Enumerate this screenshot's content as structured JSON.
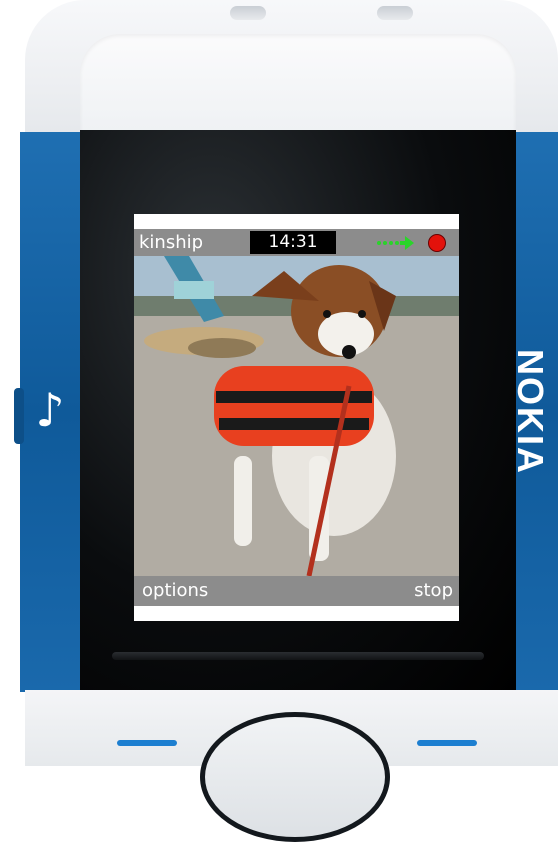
{
  "device": {
    "brand": "NOKIA",
    "music_key_icon": "music-note-icon"
  },
  "screen": {
    "app_title": "kinship",
    "clock": "14:31",
    "signal_icon": "green-dotted-arrow-icon",
    "record_icon": "red-record-dot-icon",
    "photo_subject": "dog-photo",
    "softkeys": {
      "left": "options",
      "right": "stop"
    }
  },
  "colors": {
    "status_bar": "#8c8c8c",
    "record": "#e3120b",
    "signal": "#2ad42a",
    "phone_blue": "#1f6fb2"
  }
}
